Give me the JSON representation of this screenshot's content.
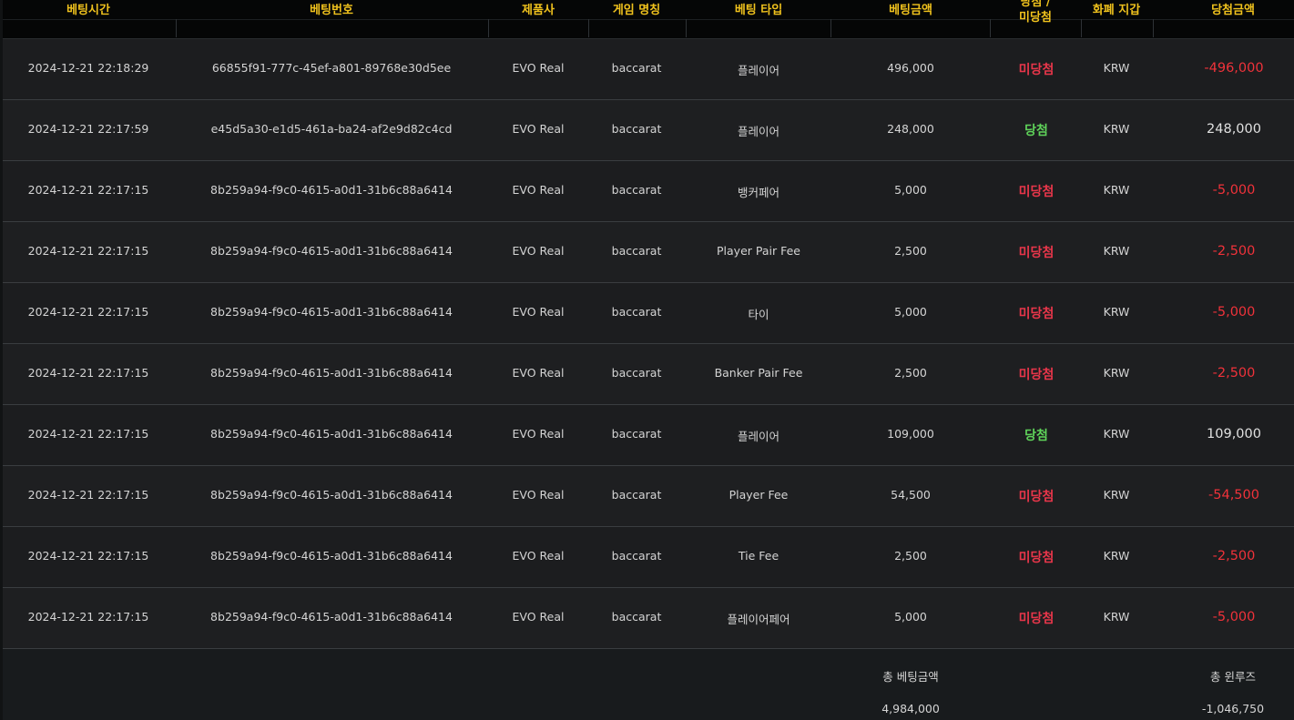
{
  "header": {
    "columns": [
      {
        "label": "베팅시간"
      },
      {
        "label": "베팅번호"
      },
      {
        "label": "제품사"
      },
      {
        "label": "게임 명칭"
      },
      {
        "label": "베팅 타입"
      },
      {
        "label": "베팅금액"
      },
      {
        "label": "당첨 /",
        "label2": "미당첨"
      },
      {
        "label": "화폐 지갑"
      },
      {
        "label": "당첨금액"
      }
    ]
  },
  "rows": [
    {
      "time": "2024-12-21 22:18:29",
      "bet_id": "66855f91-777c-45ef-a801-89768e30d5ee",
      "vendor": "EVO Real",
      "game": "baccarat",
      "bet_type": "플레이어",
      "bet_amount": "496,000",
      "result": "미당첨",
      "result_status": "lose",
      "currency": "KRW",
      "win_amount": "-496,000"
    },
    {
      "time": "2024-12-21 22:17:59",
      "bet_id": "e45d5a30-e1d5-461a-ba24-af2e9d82c4cd",
      "vendor": "EVO Real",
      "game": "baccarat",
      "bet_type": "플레이어",
      "bet_amount": "248,000",
      "result": "당첨",
      "result_status": "win",
      "currency": "KRW",
      "win_amount": "248,000"
    },
    {
      "time": "2024-12-21 22:17:15",
      "bet_id": "8b259a94-f9c0-4615-a0d1-31b6c88a6414",
      "vendor": "EVO Real",
      "game": "baccarat",
      "bet_type": "뱅커페어",
      "bet_amount": "5,000",
      "result": "미당첨",
      "result_status": "lose",
      "currency": "KRW",
      "win_amount": "-5,000"
    },
    {
      "time": "2024-12-21 22:17:15",
      "bet_id": "8b259a94-f9c0-4615-a0d1-31b6c88a6414",
      "vendor": "EVO Real",
      "game": "baccarat",
      "bet_type": "Player Pair Fee",
      "bet_amount": "2,500",
      "result": "미당첨",
      "result_status": "lose",
      "currency": "KRW",
      "win_amount": "-2,500"
    },
    {
      "time": "2024-12-21 22:17:15",
      "bet_id": "8b259a94-f9c0-4615-a0d1-31b6c88a6414",
      "vendor": "EVO Real",
      "game": "baccarat",
      "bet_type": "타이",
      "bet_amount": "5,000",
      "result": "미당첨",
      "result_status": "lose",
      "currency": "KRW",
      "win_amount": "-5,000"
    },
    {
      "time": "2024-12-21 22:17:15",
      "bet_id": "8b259a94-f9c0-4615-a0d1-31b6c88a6414",
      "vendor": "EVO Real",
      "game": "baccarat",
      "bet_type": "Banker Pair Fee",
      "bet_amount": "2,500",
      "result": "미당첨",
      "result_status": "lose",
      "currency": "KRW",
      "win_amount": "-2,500"
    },
    {
      "time": "2024-12-21 22:17:15",
      "bet_id": "8b259a94-f9c0-4615-a0d1-31b6c88a6414",
      "vendor": "EVO Real",
      "game": "baccarat",
      "bet_type": "플레이어",
      "bet_amount": "109,000",
      "result": "당첨",
      "result_status": "win",
      "currency": "KRW",
      "win_amount": "109,000"
    },
    {
      "time": "2024-12-21 22:17:15",
      "bet_id": "8b259a94-f9c0-4615-a0d1-31b6c88a6414",
      "vendor": "EVO Real",
      "game": "baccarat",
      "bet_type": "Player Fee",
      "bet_amount": "54,500",
      "result": "미당첨",
      "result_status": "lose",
      "currency": "KRW",
      "win_amount": "-54,500"
    },
    {
      "time": "2024-12-21 22:17:15",
      "bet_id": "8b259a94-f9c0-4615-a0d1-31b6c88a6414",
      "vendor": "EVO Real",
      "game": "baccarat",
      "bet_type": "Tie Fee",
      "bet_amount": "2,500",
      "result": "미당첨",
      "result_status": "lose",
      "currency": "KRW",
      "win_amount": "-2,500"
    },
    {
      "time": "2024-12-21 22:17:15",
      "bet_id": "8b259a94-f9c0-4615-a0d1-31b6c88a6414",
      "vendor": "EVO Real",
      "game": "baccarat",
      "bet_type": "플레이어페어",
      "bet_amount": "5,000",
      "result": "미당첨",
      "result_status": "lose",
      "currency": "KRW",
      "win_amount": "-5,000"
    }
  ],
  "footer": {
    "total_bet_label": "총 베팅금액",
    "total_bet_value": "4,984,000",
    "total_winloss_label": "총 윈루즈",
    "total_winloss_value": "-1,046,750"
  },
  "colors": {
    "header_text": "#f0c21d",
    "lose": "#e8364a",
    "win": "#5fd35a",
    "negative_amount": "#f0323a"
  }
}
